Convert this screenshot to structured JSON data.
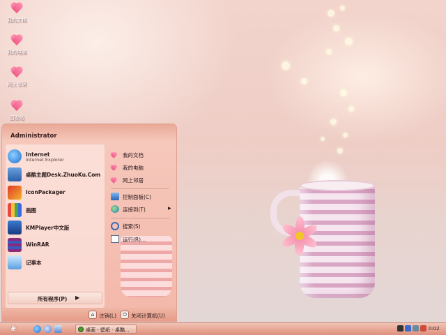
{
  "desktop": {
    "icons": [
      {
        "label": "我的文档"
      },
      {
        "label": "我的电脑"
      },
      {
        "label": "网上邻居"
      },
      {
        "label": "回收站"
      }
    ]
  },
  "start_menu": {
    "user": "Administrator",
    "programs": [
      {
        "label": "Internet",
        "sublabel": "Internet Explorer",
        "icon": "internet-explorer-icon"
      },
      {
        "label": "桌酷主题Desk.ZhuoKu.Com",
        "icon": "desk-zhuoku-icon"
      },
      {
        "label": "IconPackager",
        "icon": "iconpackager-icon"
      },
      {
        "label": "画图",
        "icon": "paint-icon"
      },
      {
        "label": "KMPlayer中文版",
        "icon": "kmplayer-icon"
      },
      {
        "label": "WinRAR",
        "icon": "winrar-icon"
      },
      {
        "label": "记事本",
        "icon": "notepad-icon"
      }
    ],
    "all_programs": "所有程序(P)",
    "all_programs_arrow": "▶",
    "places": [
      {
        "label": "我的文档",
        "icon": "heart-icon"
      },
      {
        "label": "我的电脑",
        "icon": "heart-icon"
      },
      {
        "label": "网上邻居",
        "icon": "heart-icon"
      },
      {
        "label": "控制面板(C)",
        "icon": "control-panel-icon"
      },
      {
        "label": "连接到(T)",
        "icon": "network-globe-icon",
        "arrow": "▶"
      },
      {
        "label": "搜索(S)",
        "icon": "search-icon"
      },
      {
        "label": "运行(R)...",
        "icon": "run-icon"
      }
    ],
    "logoff": "注销(L)",
    "shutdown": "关闭计算机(U)"
  },
  "taskbar": {
    "task_label": "桌面 - 壁纸 - 桌酷...",
    "clock": "0:02"
  },
  "colors": {
    "accent": "#e69b87",
    "heart": "#ee5c86"
  }
}
